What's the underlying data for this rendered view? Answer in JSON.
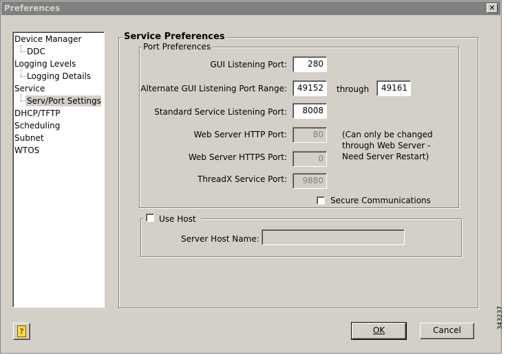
{
  "window": {
    "title": "Preferences",
    "close_glyph": "✕"
  },
  "tree": {
    "items": [
      {
        "label": "Device Manager",
        "level": 0
      },
      {
        "label": "DDC",
        "level": 1
      },
      {
        "label": "Logging Levels",
        "level": 0
      },
      {
        "label": "Logging Details",
        "level": 1
      },
      {
        "label": "Service",
        "level": 0
      },
      {
        "label": "Serv/Port Settings",
        "level": 1,
        "selected": true
      },
      {
        "label": "DHCP/TFTP",
        "level": 0
      },
      {
        "label": "Scheduling",
        "level": 0
      },
      {
        "label": "Subnet",
        "level": 0
      },
      {
        "label": "WTOS",
        "level": 0
      }
    ]
  },
  "service_prefs": {
    "title": "Service Preferences",
    "port_prefs": {
      "title": "Port Preferences",
      "gui_port_label": "GUI Listening Port:",
      "gui_port_value": "280",
      "alt_range_label": "Alternate GUI Listening Port Range:",
      "alt_range_from": "49152",
      "through_label": "through",
      "alt_range_to": "49161",
      "std_port_label": "Standard Service Listening Port:",
      "std_port_value": "8008",
      "http_label": "Web Server HTTP Port:",
      "http_value": "80",
      "https_label": "Web Server HTTPS Port:",
      "https_value": "0",
      "threadx_label": "ThreadX Service Port:",
      "threadx_value": "9880",
      "note_line1": "(Can only be changed",
      "note_line2": "through Web Server -",
      "note_line3": "Need Server Restart)",
      "secure_label": "Secure Communications",
      "secure_checked": false
    },
    "use_host": {
      "label": "Use Host",
      "checked": false,
      "server_host_label": "Server Host Name:",
      "server_host_value": ""
    }
  },
  "buttons": {
    "help_glyph": "?",
    "ok_label": "OK",
    "cancel_label": "Cancel"
  },
  "figure_id": "343237"
}
